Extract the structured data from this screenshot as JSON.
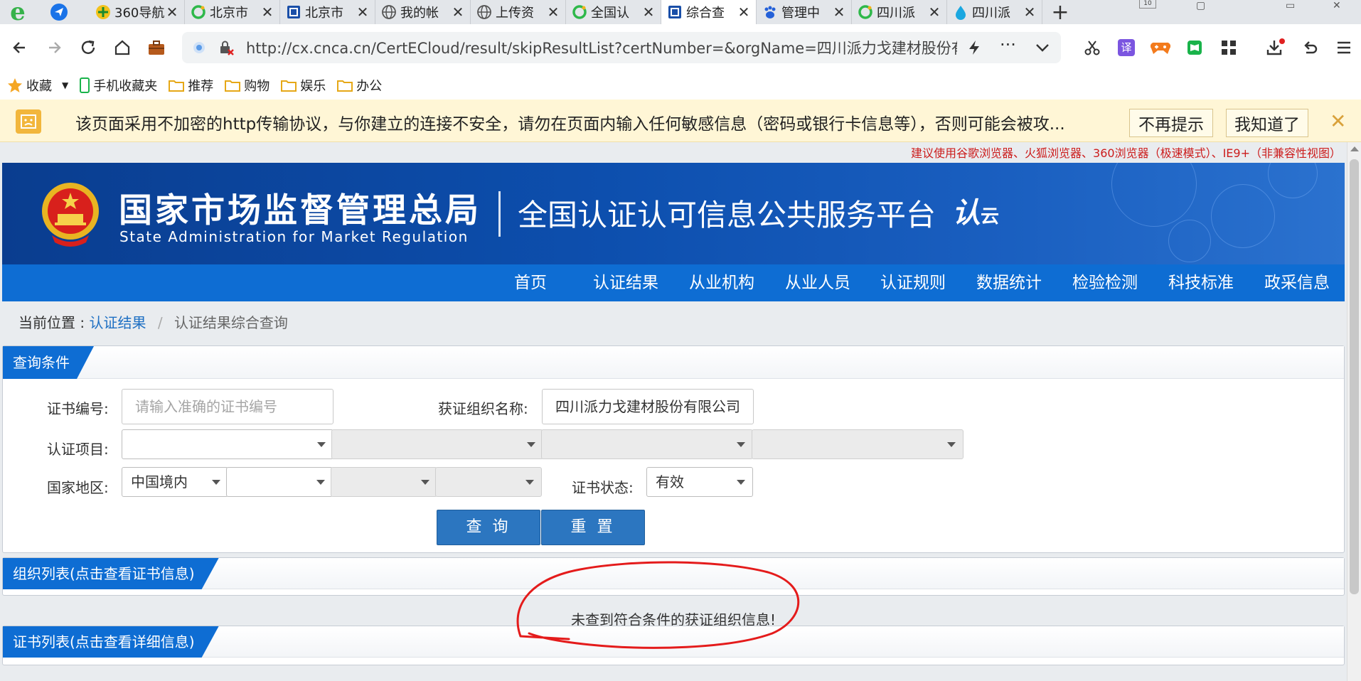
{
  "browser": {
    "tabs": [
      {
        "title": "360导航",
        "icon": "360-icon"
      },
      {
        "title": "北京市",
        "icon": "o-icon"
      },
      {
        "title": "北京市",
        "icon": "doc-icon"
      },
      {
        "title": "我的帐",
        "icon": "globe-icon"
      },
      {
        "title": "上传资",
        "icon": "globe-icon"
      },
      {
        "title": "全国认",
        "icon": "o-icon"
      },
      {
        "title": "综合查",
        "icon": "doc-icon"
      },
      {
        "title": "管理中",
        "icon": "paw-icon"
      },
      {
        "title": "四川派",
        "icon": "o-icon"
      },
      {
        "title": "四川派",
        "icon": "drop-icon"
      }
    ],
    "tab_count": "10",
    "url": "http://cx.cnca.cn/CertECloud/result/skipResultList?certNumber=&orgName=四川派力戈建材股份有限",
    "translate_label": "译",
    "bookmarks": [
      {
        "label": "收藏"
      },
      {
        "label": "手机收藏夹"
      },
      {
        "label": "推荐"
      },
      {
        "label": "购物"
      },
      {
        "label": "娱乐"
      },
      {
        "label": "办公"
      }
    ],
    "warning": {
      "text": "该页面采用不加密的http传输协议，与你建立的连接不安全，请勿在页面内输入任何敏感信息（密码或银行卡信息等），否则可能会被攻...",
      "dismiss_label": "不再提示",
      "ack_label": "我知道了"
    }
  },
  "page": {
    "browser_tip": "建议使用谷歌浏览器、火狐浏览器、360浏览器（极速模式）、IE9+（非兼容性视图）",
    "header": {
      "agency_cn": "国家市场监督管理总局",
      "agency_en": "State Administration  for  Market Regulation",
      "platform": "全国认证认可信息公共服务平台",
      "logo_main": "认",
      "logo_sub": "云"
    },
    "nav": [
      "首页",
      "认证结果",
      "从业机构",
      "从业人员",
      "认证规则",
      "数据统计",
      "检验检测",
      "科技标准",
      "政采信息"
    ],
    "breadcrumb": {
      "prefix": "当前位置 :",
      "link": "认证结果",
      "separator": "/",
      "current": "认证结果综合查询"
    },
    "query": {
      "panel_title": "查询条件",
      "cert_no_label": "证书编号:",
      "cert_no_placeholder": "请输入准确的证书编号",
      "org_name_label": "获证组织名称:",
      "org_name_value": "四川派力戈建材股份有限公司",
      "project_label": "认证项目:",
      "region_label": "国家地区:",
      "region_value": "中国境内",
      "status_label": "证书状态:",
      "status_value": "有效",
      "search_label": "查 询",
      "reset_label": "重 置"
    },
    "org_list": {
      "panel_title": "组织列表(点击查看证书信息)",
      "empty_message": "未查到符合条件的获证组织信息!"
    },
    "cert_list": {
      "panel_title": "证书列表(点击查看详细信息)"
    }
  }
}
